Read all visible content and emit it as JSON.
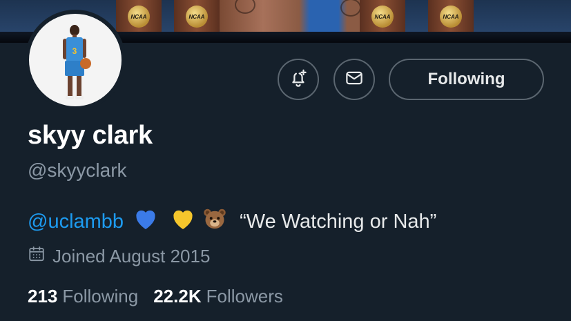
{
  "banner": {
    "trophy_labels": [
      "NCAA",
      "NCAA",
      "NCAA",
      "NCAA"
    ]
  },
  "profile": {
    "display_name": "skyy clark",
    "handle": "@skyyclark",
    "jersey_number": "3",
    "bio": {
      "mention": "@uclambb",
      "emojis": [
        "blue-heart",
        "yellow-heart",
        "bear-face"
      ],
      "quote": "“We Watching or Nah”"
    },
    "joined": "Joined August 2015",
    "stats": {
      "following_count": "213",
      "following_label": "Following",
      "followers_count": "22.2K",
      "followers_label": "Followers"
    }
  },
  "actions": {
    "notify_icon": "bell-plus-icon",
    "message_icon": "envelope-icon",
    "following_button_label": "Following"
  },
  "colors": {
    "background": "#15202b",
    "link": "#1d9bf0",
    "secondary_text": "#8b98a5",
    "button_border": "#5b6670"
  }
}
